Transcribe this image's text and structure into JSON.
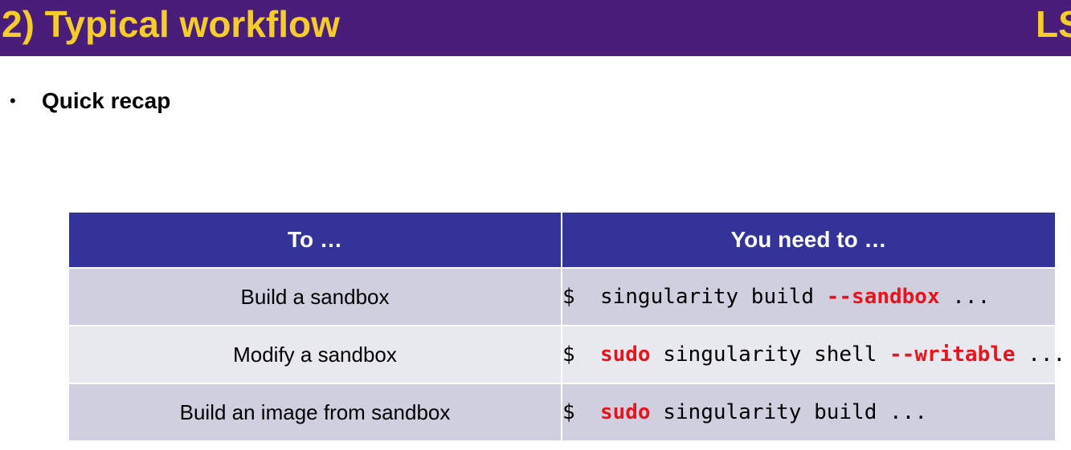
{
  "header": {
    "title": "2) Typical workflow",
    "logo_text": "LS"
  },
  "bullet": {
    "symbol": "•",
    "text": "Quick recap"
  },
  "table": {
    "headers": [
      "To …",
      "You need to …"
    ],
    "rows": [
      {
        "task": "Build a sandbox",
        "command": [
          {
            "text": "$  singularity build ",
            "highlight": false
          },
          {
            "text": "--sandbox",
            "highlight": true
          },
          {
            "text": " ...",
            "highlight": false
          }
        ]
      },
      {
        "task": "Modify a sandbox",
        "command": [
          {
            "text": "$  ",
            "highlight": false
          },
          {
            "text": "sudo",
            "highlight": true
          },
          {
            "text": " singularity shell ",
            "highlight": false
          },
          {
            "text": "--writable",
            "highlight": true
          },
          {
            "text": " ...",
            "highlight": false
          }
        ]
      },
      {
        "task": "Build an image from sandbox",
        "command": [
          {
            "text": "$  ",
            "highlight": false
          },
          {
            "text": "sudo",
            "highlight": true
          },
          {
            "text": " singularity build ...",
            "highlight": false
          }
        ]
      }
    ]
  },
  "colors": {
    "header_bg": "#4a1d7a",
    "title": "#f5cd2a",
    "table_header_bg": "#333399",
    "row_dark": "#cfcfe0",
    "row_light": "#e8e8ef",
    "highlight": "#e8141c"
  }
}
